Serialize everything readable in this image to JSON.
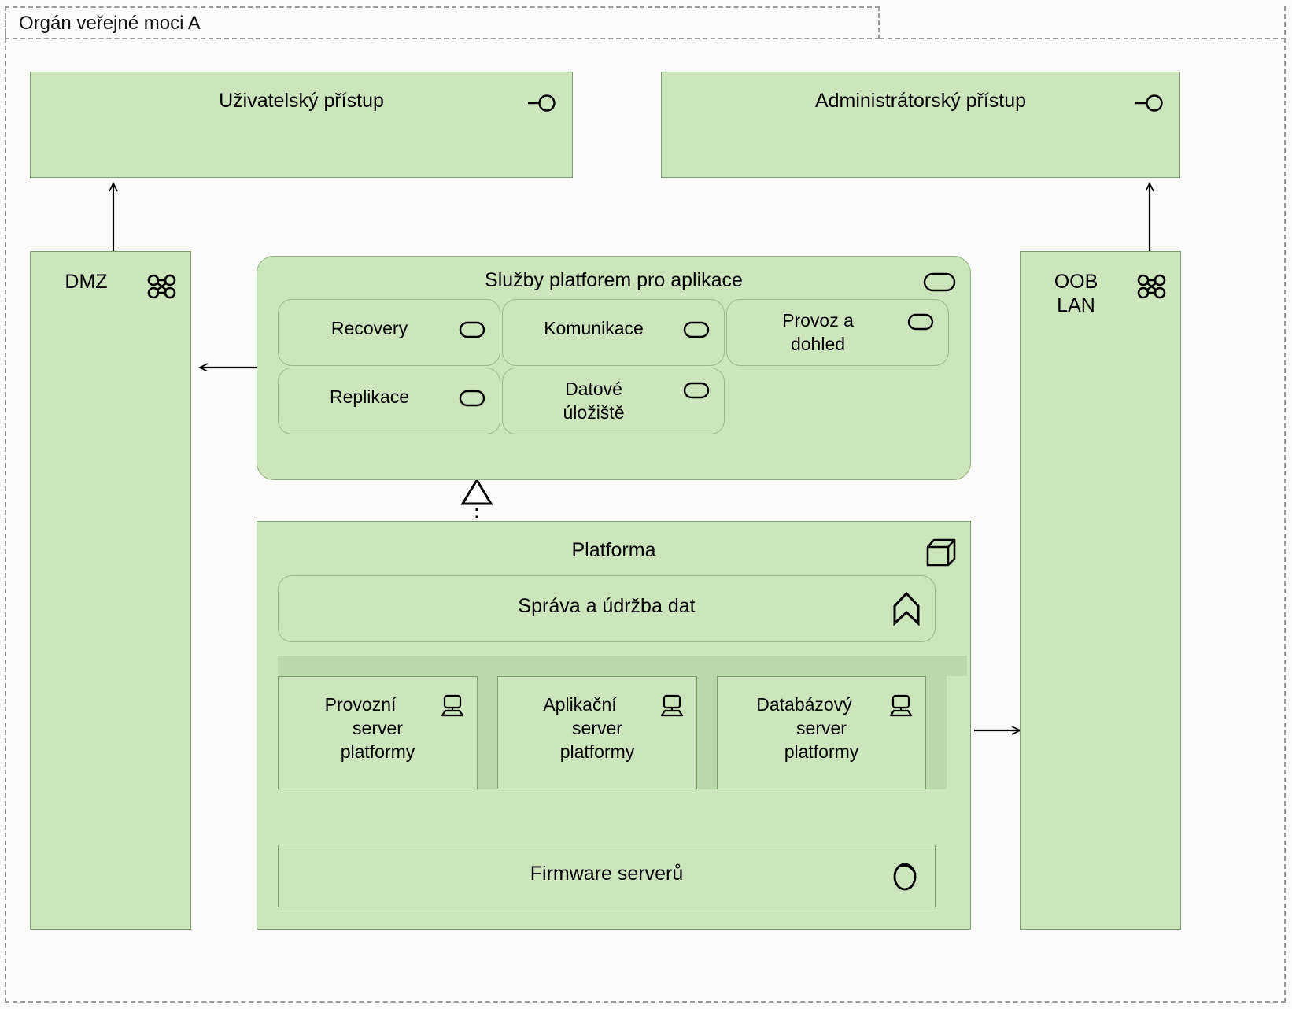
{
  "diagram": {
    "type": "archimate-technology-layer",
    "group": {
      "label": "Orgán veřejné moci A",
      "style": "dashed-grouping"
    },
    "colors": {
      "element_fill": "#cce5bd",
      "element_stroke": "#7d9c6b",
      "node_top_fill": "#bad8a9",
      "group_stroke": "#9a9a9a",
      "background": "#fbfbfb",
      "text": "#000000"
    },
    "access_interfaces": [
      {
        "id": "uzivatelsky",
        "label": "Uživatelský přístup",
        "icon": "interface-lollipop-icon"
      },
      {
        "id": "administratorsky",
        "label": "Administrátorský přístup",
        "icon": "interface-lollipop-icon"
      }
    ],
    "networks": [
      {
        "id": "dmz",
        "label": "DMZ",
        "icon": "communication-network-icon"
      },
      {
        "id": "oob-lan",
        "label": "OOB\nLAN",
        "label_line1": "OOB",
        "label_line2": "LAN",
        "icon": "communication-network-icon"
      }
    ],
    "platform_services": {
      "title": "Služby platforem pro aplikace",
      "icon": "technology-service-icon",
      "items": [
        {
          "id": "recovery",
          "label": "Recovery",
          "icon": "technology-service-icon"
        },
        {
          "id": "komunikace",
          "label": "Komunikace",
          "icon": "technology-service-icon"
        },
        {
          "id": "provoz-a-dohled",
          "label": "Provoz a dohled",
          "label_line1": "Provoz a",
          "label_line2": "dohled",
          "icon": "technology-service-icon"
        },
        {
          "id": "replikace",
          "label": "Replikace",
          "icon": "technology-service-icon"
        },
        {
          "id": "datove-uloziste",
          "label": "Datové úložiště",
          "label_line1": "Datové",
          "label_line2": "úložiště",
          "icon": "technology-service-icon"
        }
      ]
    },
    "platform": {
      "title": "Platforma",
      "icon": "node-icon",
      "function": {
        "id": "sprava-a-udrzba-dat",
        "label": "Správa a údržba dat",
        "icon": "technology-function-icon"
      },
      "servers": [
        {
          "id": "provozni-server",
          "label": "Provozní server platformy",
          "label_line1": "Provozní",
          "label_line2": "server",
          "label_line3": "platformy",
          "icon": "device-icon"
        },
        {
          "id": "aplikacni-server",
          "label": "Aplikační server platformy",
          "label_line1": "Aplikační",
          "label_line2": "server",
          "label_line3": "platformy",
          "icon": "device-icon"
        },
        {
          "id": "databazovy-server",
          "label": "Databázový server platformy",
          "label_line1": "Databázový",
          "label_line2": "server",
          "label_line3": "platformy",
          "icon": "device-icon"
        }
      ],
      "firmware": {
        "id": "firmware-serveru",
        "label": "Firmware serverů",
        "icon": "system-software-icon"
      }
    },
    "relationships": [
      {
        "type": "serving",
        "from": "dmz",
        "to": "uzivatelsky",
        "style": "solid-open-arrow"
      },
      {
        "type": "serving",
        "from": "oob-lan",
        "to": "administratorsky",
        "style": "solid-open-arrow"
      },
      {
        "type": "serving",
        "from": "sluzby-platforem",
        "to": "dmz",
        "style": "solid-open-arrow"
      },
      {
        "type": "serving",
        "from": "platforma",
        "to": "oob-lan",
        "style": "solid-open-arrow"
      },
      {
        "type": "realization",
        "from": "platforma",
        "to": "sluzby-platforem",
        "style": "dotted-hollow-triangle"
      },
      {
        "type": "serving",
        "from": "firmware-serveru",
        "to": "provozni-server",
        "style": "solid-open-arrow"
      },
      {
        "type": "serving",
        "from": "firmware-serveru",
        "to": "aplikacni-server",
        "style": "solid-open-arrow"
      },
      {
        "type": "serving",
        "from": "firmware-serveru",
        "to": "databazovy-server",
        "style": "solid-open-arrow"
      }
    ]
  }
}
